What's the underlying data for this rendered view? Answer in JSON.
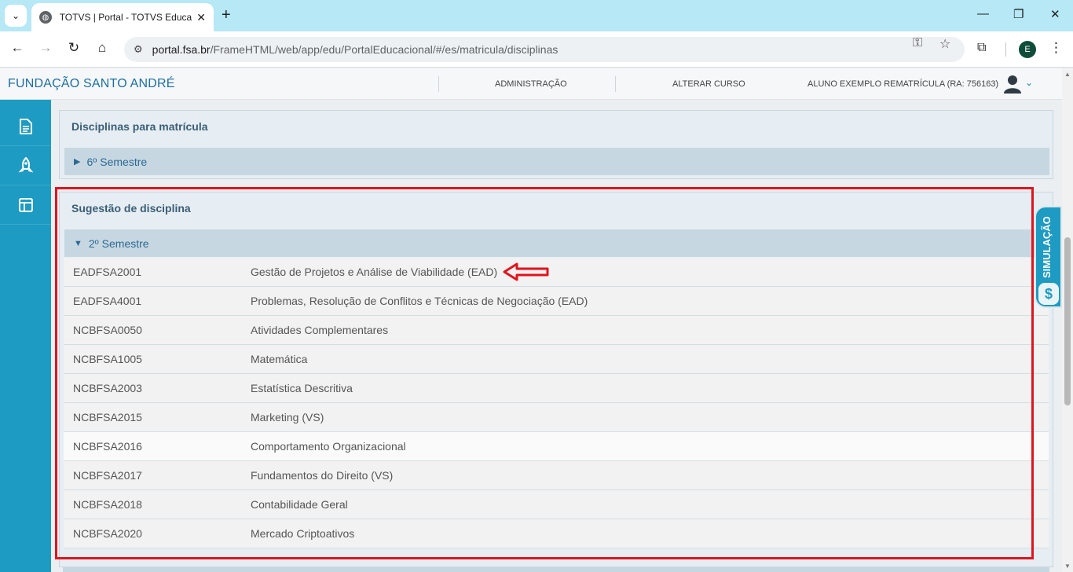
{
  "browser": {
    "tab_title": "TOTVS | Portal - TOTVS Educacional",
    "url_host": "portal.fsa.br",
    "url_path": "/FrameHTML/web/app/edu/PortalEducacional/#/es/matricula/disciplinas",
    "profile_initial": "E"
  },
  "header": {
    "brand": "FUNDAÇÃO SANTO ANDRÉ",
    "admin_label": "ADMINISTRAÇÃO",
    "change_course_label": "ALTERAR CURSO",
    "user_label": "ALUNO EXEMPLO REMATRÍCULA (RA: 756163)"
  },
  "panel_enroll": {
    "title": "Disciplinas para matrícula",
    "group_label": "6º Semestre"
  },
  "panel_suggest": {
    "title": "Sugestão de disciplina",
    "group_label": "2º Semestre",
    "rows": [
      {
        "code": "EADFSA2001",
        "name": "Gestão de Projetos e Análise de Viabilidade (EAD)"
      },
      {
        "code": "EADFSA4001",
        "name": "Problemas, Resolução de Conflitos e Técnicas de Negociação (EAD)"
      },
      {
        "code": "NCBFSA0050",
        "name": "Atividades Complementares"
      },
      {
        "code": "NCBFSA1005",
        "name": "Matemática"
      },
      {
        "code": "NCBFSA2003",
        "name": "Estatística Descritiva"
      },
      {
        "code": "NCBFSA2015",
        "name": "Marketing (VS)"
      },
      {
        "code": "NCBFSA2016",
        "name": "Comportamento Organizacional"
      },
      {
        "code": "NCBFSA2017",
        "name": "Fundamentos do Direito (VS)"
      },
      {
        "code": "NCBFSA2018",
        "name": "Contabilidade Geral"
      },
      {
        "code": "NCBFSA2020",
        "name": "Mercado Criptoativos"
      }
    ]
  },
  "simulation": {
    "label": "SIMULAÇÃO",
    "currency_symbol": "$"
  },
  "colors": {
    "accent": "#1d9bc2",
    "highlight": "#e0141e"
  }
}
